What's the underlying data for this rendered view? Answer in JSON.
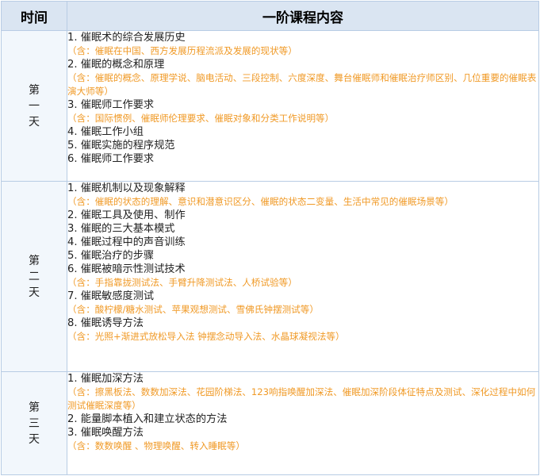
{
  "header": {
    "time": "时间",
    "title": "一阶课程内容"
  },
  "days": [
    {
      "label": [
        "第",
        "一",
        "天"
      ],
      "lines": [
        {
          "type": "item",
          "text": "1. 催眠术的综合发展历史"
        },
        {
          "type": "note",
          "text": "（含：催眠在中国、西方发展历程流派及发展的现状等）"
        },
        {
          "type": "item",
          "text": "2. 催眠的概念和原理"
        },
        {
          "type": "note",
          "text": "（含：催眠的概念、原理学说、脑电活动、三段控制、六度深度、舞台催眠师和催眠治疗师区别、几位重要的催眠表演大师等）"
        },
        {
          "type": "item",
          "text": "3. 催眠师工作要求"
        },
        {
          "type": "note",
          "text": "（含：国际惯例、催眠师伦理要求、催眠对象和分类工作说明等）"
        },
        {
          "type": "item",
          "text": "4. 催眠工作小组"
        },
        {
          "type": "item",
          "text": "5. 催眠实施的程序规范"
        },
        {
          "type": "item",
          "text": "6. 催眠师工作要求"
        }
      ]
    },
    {
      "label": [
        "第",
        "二",
        "天"
      ],
      "lines": [
        {
          "type": "item",
          "text": "1. 催眠机制以及现象解释"
        },
        {
          "type": "note",
          "text": "（含：催眠的状态的理解、意识和潜意识区分、催眠的状态二变量、生活中常见的催眠场景等）"
        },
        {
          "type": "item",
          "text": "2. 催眠工具及使用、制作"
        },
        {
          "type": "item",
          "text": "3. 催眠的三大基本模式"
        },
        {
          "type": "item",
          "text": "4. 催眠过程中的声音训练"
        },
        {
          "type": "item",
          "text": "5. 催眠治疗的步骤"
        },
        {
          "type": "item",
          "text": "6. 催眠被暗示性测试技术"
        },
        {
          "type": "note",
          "text": "（含：手指靠拢测试法、手臂升降测试法、人桥试验等）"
        },
        {
          "type": "item",
          "text": "7. 催眠敏感度测试"
        },
        {
          "type": "note",
          "text": "（含：酸柠檬/糖水测试、苹果观想测试、雪佛氏钟摆测试等）"
        },
        {
          "type": "item",
          "text": "8. 催眠诱导方法"
        },
        {
          "type": "note",
          "text": "（含：光照+渐进式放松导入法 钟摆念动导入法、水晶球凝视法等）"
        }
      ]
    },
    {
      "label": [
        "第",
        "三",
        "天"
      ],
      "lines": [
        {
          "type": "item",
          "text": "1. 催眠加深方法"
        },
        {
          "type": "note",
          "text": "（含：擦黑板法、数数加深法、花园阶梯法、123响指唤醒加深法、催眠加深阶段体征特点及测试、深化过程中如何测试催眠深度等）"
        },
        {
          "type": "item",
          "text": "2. 能量脚本植入和建立状态的方法"
        },
        {
          "type": "item",
          "text": "3. 催眠唤醒方法"
        },
        {
          "type": "note",
          "text": "（含：数数唤醒 、物理唤醒、转入睡眠等）"
        }
      ]
    }
  ]
}
